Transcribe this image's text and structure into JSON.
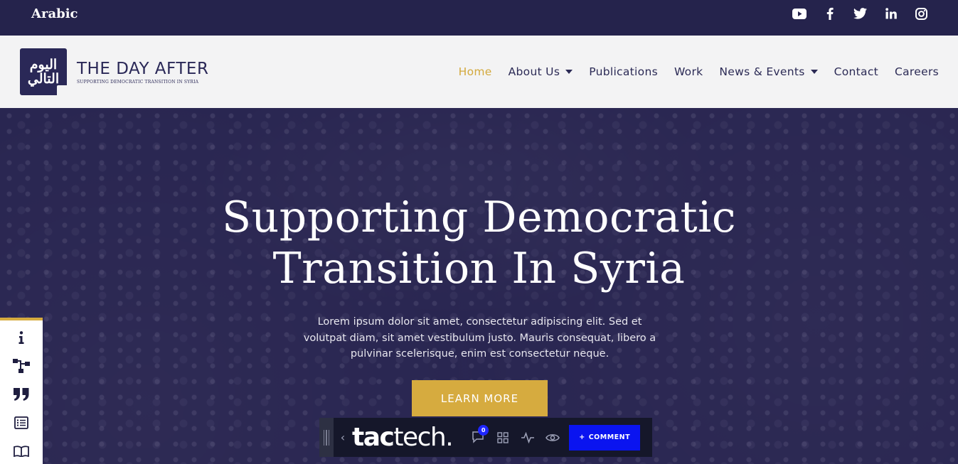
{
  "topbar": {
    "language_link": "Arabic",
    "social": [
      "youtube-icon",
      "facebook-icon",
      "twitter-icon",
      "linkedin-icon",
      "instagram-icon"
    ]
  },
  "header": {
    "logo_arabic": "اليوم التالي",
    "brand_name": "THE DAY AFTER",
    "brand_tagline": "SUPPORTING DEMOCRATIC TRANSITION IN SYRIA",
    "nav": [
      {
        "label": "Home",
        "active": true
      },
      {
        "label": "About Us",
        "dropdown": true
      },
      {
        "label": "Publications"
      },
      {
        "label": "Work"
      },
      {
        "label": "News & Events",
        "dropdown": true
      },
      {
        "label": "Contact"
      },
      {
        "label": "Careers"
      }
    ]
  },
  "hero": {
    "title_line1": "Supporting Democratic",
    "title_line2": "Transition In Syria",
    "body": "Lorem ipsum dolor sit amet, consectetur adipiscing elit. Sed et volutpat diam, sit amet vestibulum justo. Mauris consequat, libero a pulvinar scelerisque, enim est consectetur neque.",
    "cta_label": "LEARN MORE"
  },
  "sidebar": {
    "icons": [
      "info-icon",
      "sitemap-icon",
      "quote-icon",
      "list-icon",
      "book-icon"
    ]
  },
  "tactech_toolbar": {
    "logo_prefix": "tac",
    "logo_suffix": "tech.",
    "comment_count": "0",
    "comment_button": "COMMENT",
    "icons": [
      "comments-icon",
      "grid-icon",
      "activity-icon",
      "eye-icon"
    ]
  },
  "colors": {
    "navy": "#25234c",
    "gold": "#d6ab3f",
    "toolbar_blue": "#0a14f0"
  }
}
